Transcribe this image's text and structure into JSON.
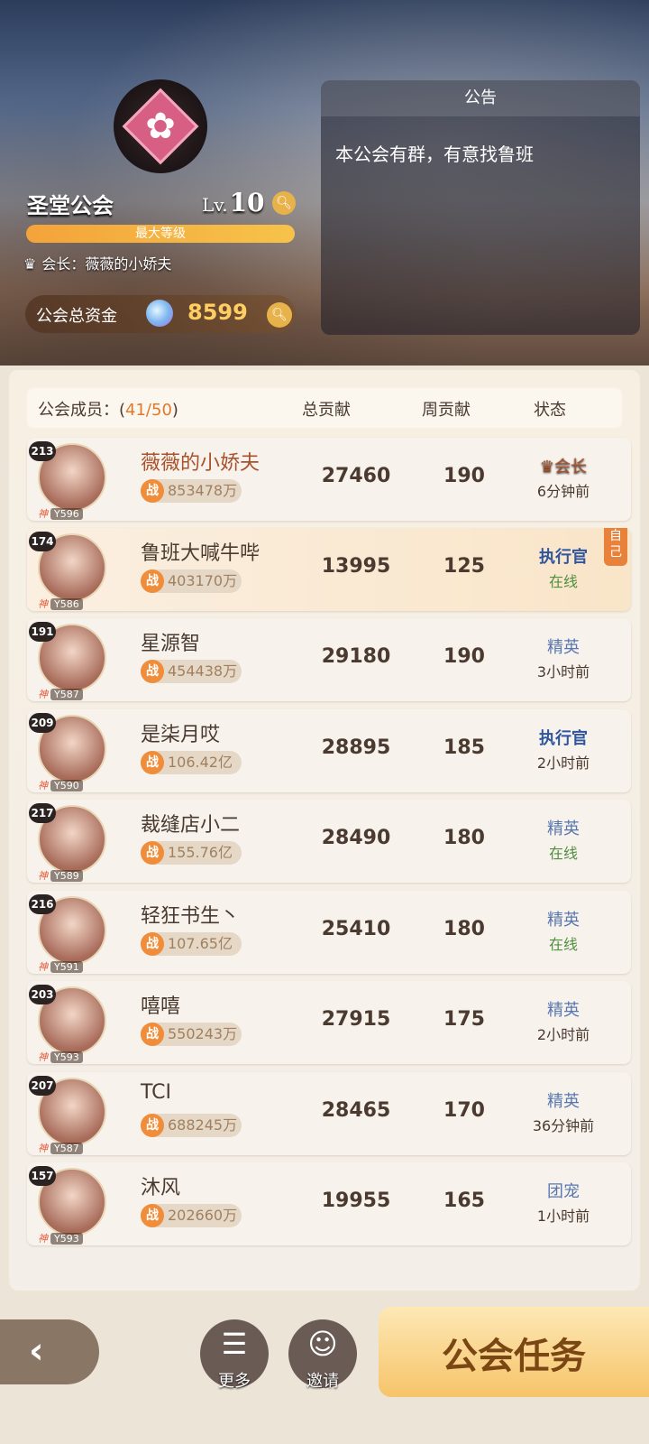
{
  "guild": {
    "name": "圣堂公会",
    "level_prefix": "Lv.",
    "level": "10",
    "max_level_label": "最大等级",
    "leader_label": "会长：",
    "leader_name": "薇薇的小娇夫",
    "funds_label": "公会总资金",
    "funds_value": "8599"
  },
  "notice": {
    "title": "公告",
    "text": "本公会有群，有意找鲁班"
  },
  "members": {
    "label": "公会成员：(",
    "count": "41/50",
    "close_paren": ")",
    "col_total": "总贡献",
    "col_week": "周贡献",
    "col_status": "状态",
    "self_tag": "自己",
    "power_prefix": "战",
    "rows": [
      {
        "avatar_level": "213",
        "rank": "Y596",
        "name": "薇薇的小娇夫",
        "power": "853478万",
        "total": "27460",
        "week": "190",
        "role": "会长",
        "status": "6分钟前"
      },
      {
        "avatar_level": "174",
        "rank": "Y586",
        "name": "鲁班大喊牛哔",
        "power": "403170万",
        "total": "13995",
        "week": "125",
        "role": "执行官",
        "status": "在线"
      },
      {
        "avatar_level": "191",
        "rank": "Y587",
        "name": "星源智",
        "power": "454438万",
        "total": "29180",
        "week": "190",
        "role": "精英",
        "status": "3小时前"
      },
      {
        "avatar_level": "209",
        "rank": "Y590",
        "name": "是柒月哎",
        "power": "106.42亿",
        "total": "28895",
        "week": "185",
        "role": "执行官",
        "status": "2小时前"
      },
      {
        "avatar_level": "217",
        "rank": "Y589",
        "name": "裁缝店小二",
        "power": "155.76亿",
        "total": "28490",
        "week": "180",
        "role": "精英",
        "status": "在线"
      },
      {
        "avatar_level": "216",
        "rank": "Y591",
        "name": "轻狂书生丶",
        "power": "107.65亿",
        "total": "25410",
        "week": "180",
        "role": "精英",
        "status": "在线"
      },
      {
        "avatar_level": "203",
        "rank": "Y593",
        "name": "嘻嘻",
        "power": "550243万",
        "total": "27915",
        "week": "175",
        "role": "精英",
        "status": "2小时前"
      },
      {
        "avatar_level": "207",
        "rank": "Y587",
        "name": "TCI",
        "power": "688245万",
        "total": "28465",
        "week": "170",
        "role": "精英",
        "status": "36分钟前"
      },
      {
        "avatar_level": "157",
        "rank": "Y593",
        "name": "沐风",
        "power": "202660万",
        "total": "19955",
        "week": "165",
        "role": "团宠",
        "status": "1小时前"
      }
    ]
  },
  "bottom": {
    "more_label": "更多",
    "invite_label": "邀请",
    "task_label": "公会任务"
  }
}
